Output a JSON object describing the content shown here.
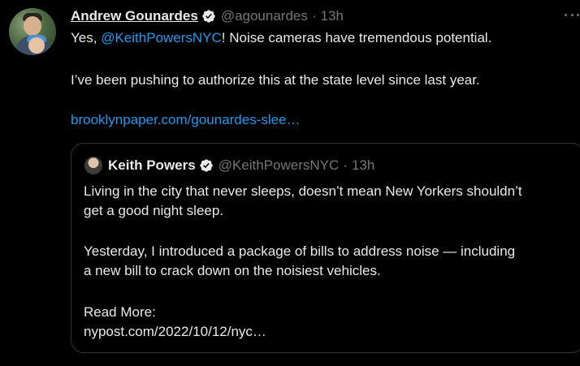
{
  "tweet": {
    "author_name": "Andrew Gounardes",
    "author_handle": "@agounardes",
    "separator": "·",
    "time": "13h",
    "text_prefix": "Yes, ",
    "mention": "@KeithPowersNYC",
    "text_line1_suffix": "! Noise cameras have tremendous potential.",
    "text_line2": "I’ve been pushing to authorize this at the state level since last year.",
    "link": "brooklynpaper.com/gounardes-slee…",
    "avatar_icon": "profile-photo-icon",
    "verified_icon": "verified-badge-icon",
    "more_icon": "more-options-icon"
  },
  "quote": {
    "author_name": "Keith Powers",
    "author_handle": "@KeithPowersNYC",
    "separator": "·",
    "time": "13h",
    "line1": "Living in the city that never sleeps, doesn’t mean New Yorkers shouldn’t",
    "line2": "get a good night sleep.",
    "line3": "Yesterday, I introduced a package of bills to address noise — including",
    "line4": "a new bill to crack down on the noisiest vehicles.",
    "line5": "Read More:",
    "line6": "nypost.com/2022/10/12/nyc…"
  },
  "colors": {
    "background": "#000000",
    "text": "#e7e9ea",
    "secondary": "#71767b",
    "link": "#1d9bf0",
    "border": "#2f3336"
  }
}
